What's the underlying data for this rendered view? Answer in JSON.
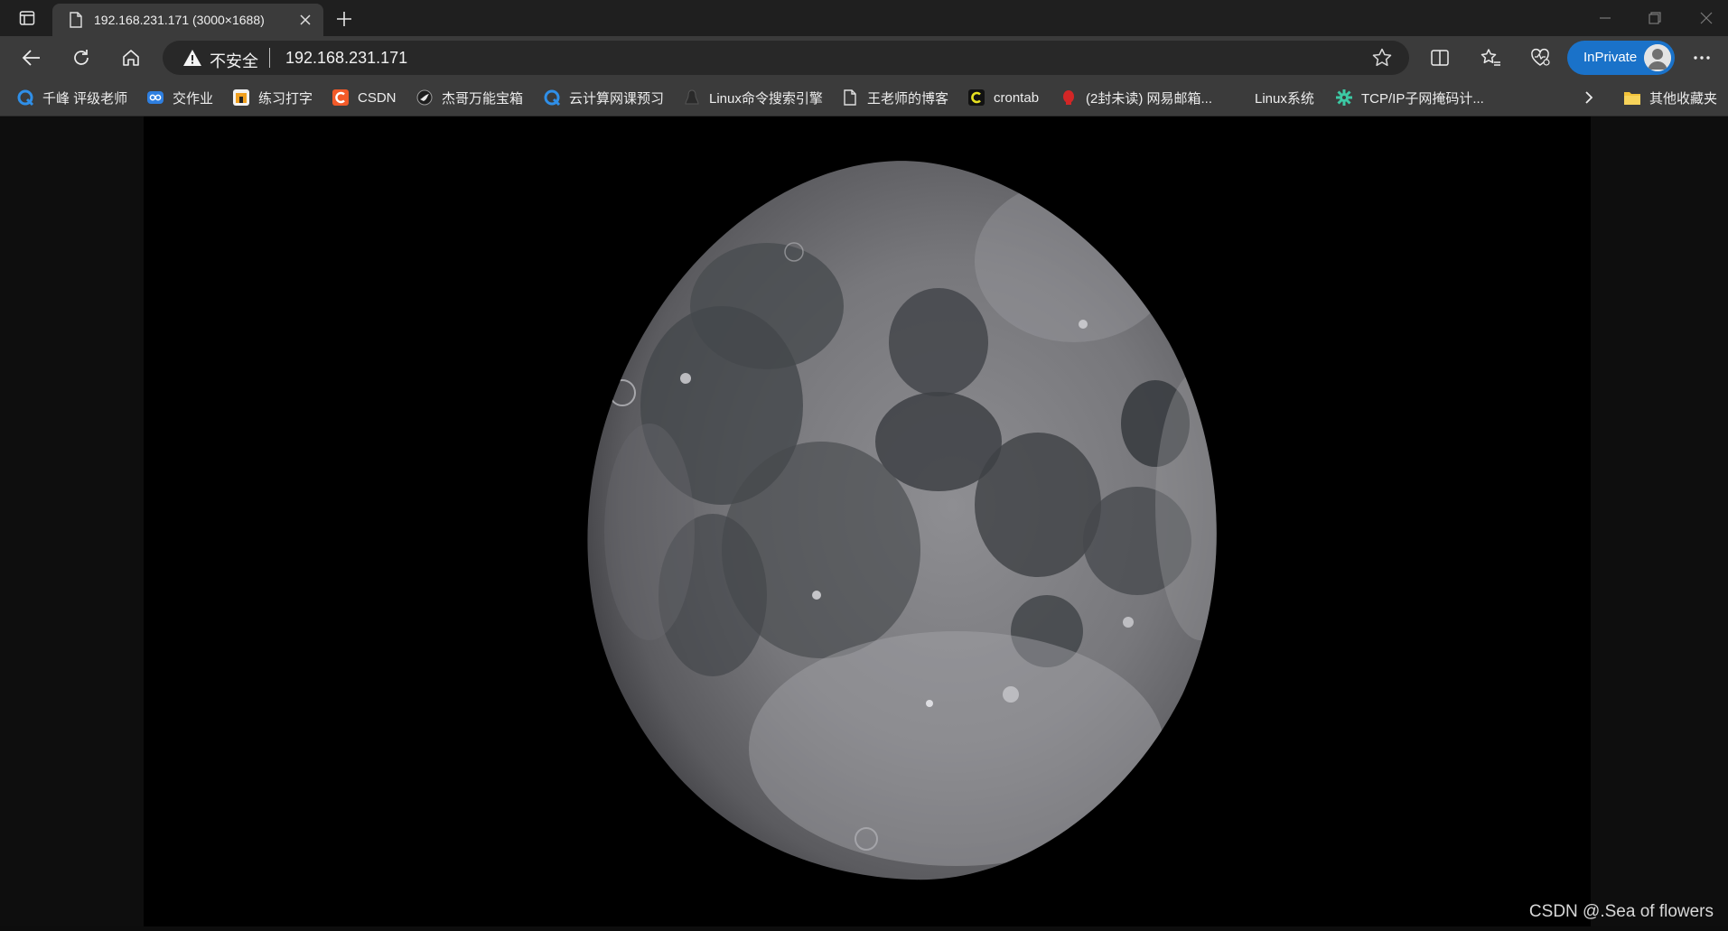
{
  "tab": {
    "title": "192.168.231.171 (3000×1688)"
  },
  "address_bar": {
    "security_label": "不安全",
    "url": "192.168.231.171"
  },
  "profile": {
    "inprivate_label": "InPrivate"
  },
  "bookmarks": {
    "items": [
      {
        "label": "千峰 评级老师",
        "icon": "qianfeng-icon"
      },
      {
        "label": "交作业",
        "icon": "blue-badge-icon"
      },
      {
        "label": "练习打字",
        "icon": "typing-icon"
      },
      {
        "label": "CSDN",
        "icon": "csdn-icon"
      },
      {
        "label": "杰哥万能宝箱",
        "icon": "bird-icon"
      },
      {
        "label": "云计算网课预习",
        "icon": "qianfeng-icon"
      },
      {
        "label": "Linux命令搜索引擎",
        "icon": "linux-icon"
      },
      {
        "label": "王老师的博客",
        "icon": "page-icon"
      },
      {
        "label": "crontab",
        "icon": "crontab-icon"
      },
      {
        "label": "(2封未读) 网易邮箱...",
        "icon": "mail-icon"
      },
      {
        "label": "Linux系统",
        "icon": "blank"
      },
      {
        "label": "TCP/IP子网掩码计...",
        "icon": "gear-icon"
      }
    ],
    "other_folder": "其他收藏夹"
  },
  "watermark": "CSDN @.Sea of flowers",
  "colors": {
    "tab_strip": "#1f1f1f",
    "toolbar": "#3b3b3b",
    "omnibox": "#282828",
    "inprivate": "#1a72c9",
    "image_background": "#000000"
  }
}
